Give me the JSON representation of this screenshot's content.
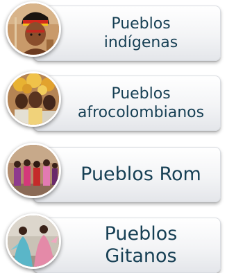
{
  "groups": [
    {
      "label": "Pueblos\nindígenas",
      "photo_icon": "indigenous-person-photo"
    },
    {
      "label": "Pueblos\nafrocolombianos",
      "photo_icon": "afrocolombian-people-photo"
    },
    {
      "label": "Pueblos Rom",
      "photo_icon": "rom-dancers-photo"
    },
    {
      "label": "Pueblos\nGitanos",
      "photo_icon": "gitano-dancers-photo"
    }
  ]
}
